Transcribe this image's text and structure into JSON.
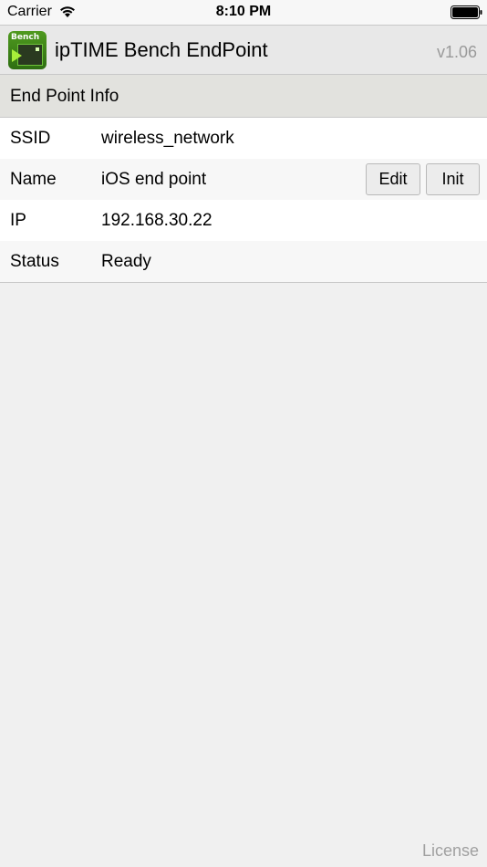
{
  "status_bar": {
    "carrier": "Carrier",
    "time": "8:10 PM",
    "icons": [
      "wifi-icon",
      "battery-icon"
    ]
  },
  "header": {
    "icon_label": "Bench",
    "title": "ipTIME Bench EndPoint",
    "version": "v1.06"
  },
  "section": {
    "title": "End Point Info"
  },
  "info": {
    "ssid_label": "SSID",
    "ssid_value": "wireless_network",
    "name_label": "Name",
    "name_value": "iOS end point",
    "ip_label": "IP",
    "ip_value": "192.168.30.22",
    "status_label": "Status",
    "status_value": "Ready"
  },
  "buttons": {
    "edit": "Edit",
    "init": "Init"
  },
  "footer": {
    "license": "License"
  },
  "colors": {
    "background": "#f0f0f0",
    "header_bg": "#e8e8e8",
    "section_bg": "#e2e2de",
    "muted_text": "#9a9a9a",
    "icon_green": "#4f9a1f"
  }
}
